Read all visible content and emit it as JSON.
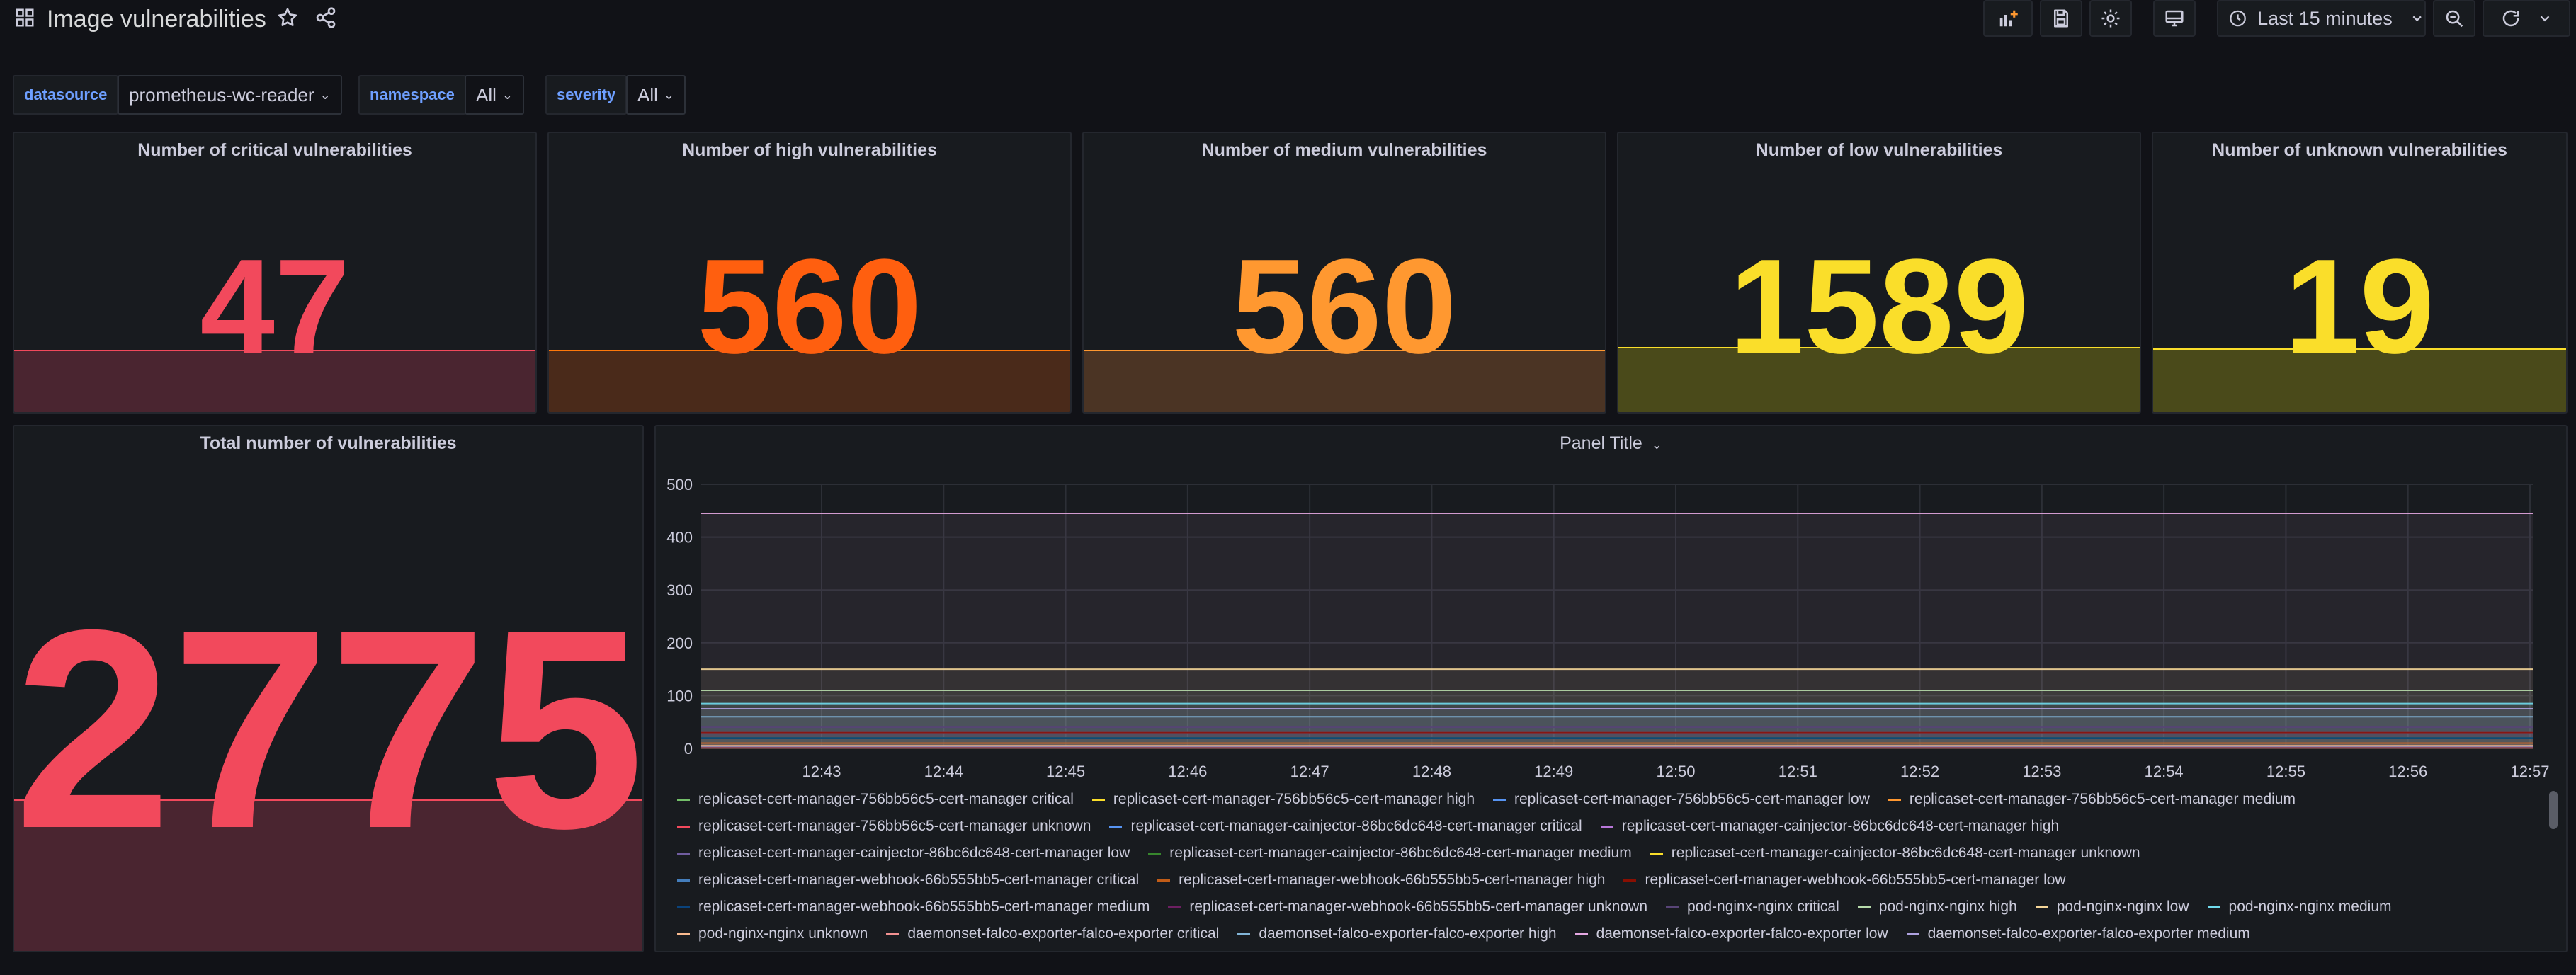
{
  "dashboard": {
    "title": "Image vulnerabilities"
  },
  "toolbar": {
    "time_range": "Last 15 minutes"
  },
  "variables": [
    {
      "label": "datasource",
      "value": "prometheus-wc-reader"
    },
    {
      "label": "namespace",
      "value": "All"
    },
    {
      "label": "severity",
      "value": "All"
    }
  ],
  "stats": [
    {
      "title": "Number of critical vulnerabilities",
      "value": "47",
      "color": "#f2495c",
      "spark": "#4a2530",
      "line": "#f2495c"
    },
    {
      "title": "Number of high vulnerabilities",
      "value": "560",
      "color": "#ff5f0f",
      "spark": "#4a2a1a",
      "line": "#ff780a"
    },
    {
      "title": "Number of medium vulnerabilities",
      "value": "560",
      "color": "#ff9830",
      "spark": "#4b3424",
      "line": "#ff9830"
    },
    {
      "title": "Number of low vulnerabilities",
      "value": "1589",
      "color": "#fade2a",
      "spark": "#4a4a1a",
      "line": "#fade2a"
    },
    {
      "title": "Number of unknown vulnerabilities",
      "value": "19",
      "color": "#fade2a",
      "spark": "#4a4a1a",
      "line": "#fade2a"
    }
  ],
  "total": {
    "title": "Total number of vulnerabilities",
    "value": "2775",
    "color": "#f2495c",
    "spark": "#4a2530",
    "line": "#f2495c"
  },
  "timeseries": {
    "title": "Panel Title"
  },
  "chart_data": {
    "type": "area",
    "title": "Panel Title",
    "x": [
      "12:43",
      "12:44",
      "12:45",
      "12:46",
      "12:47",
      "12:48",
      "12:49",
      "12:50",
      "12:51",
      "12:52",
      "12:53",
      "12:54",
      "12:55",
      "12:56",
      "12:57"
    ],
    "yticks": [
      0,
      100,
      200,
      300,
      400,
      500
    ],
    "ylim": [
      0,
      500
    ],
    "grid": true,
    "legend_placement": "bottom",
    "series": [
      {
        "name": "replicaset-cert-manager-756bb56c5-cert-manager critical",
        "color": "#73bf69",
        "value": 2
      },
      {
        "name": "replicaset-cert-manager-756bb56c5-cert-manager high",
        "color": "#fade2a",
        "value": 10
      },
      {
        "name": "replicaset-cert-manager-756bb56c5-cert-manager low",
        "color": "#5794f2",
        "value": 30
      },
      {
        "name": "replicaset-cert-manager-756bb56c5-cert-manager medium",
        "color": "#ff9830",
        "value": 20
      },
      {
        "name": "replicaset-cert-manager-756bb56c5-cert-manager unknown",
        "color": "#f2495c",
        "value": 1
      },
      {
        "name": "replicaset-cert-manager-cainjector-86bc6dc648-cert-manager critical",
        "color": "#5794f2",
        "value": 2
      },
      {
        "name": "replicaset-cert-manager-cainjector-86bc6dc648-cert-manager high",
        "color": "#b877d9",
        "value": 10
      },
      {
        "name": "replicaset-cert-manager-cainjector-86bc6dc648-cert-manager low",
        "color": "#705da0",
        "value": 30
      },
      {
        "name": "replicaset-cert-manager-cainjector-86bc6dc648-cert-manager medium",
        "color": "#37872d",
        "value": 20
      },
      {
        "name": "replicaset-cert-manager-cainjector-86bc6dc648-cert-manager unknown",
        "color": "#fade2a",
        "value": 1
      },
      {
        "name": "replicaset-cert-manager-webhook-66b555bb5-cert-manager critical",
        "color": "#447ebc",
        "value": 2
      },
      {
        "name": "replicaset-cert-manager-webhook-66b555bb5-cert-manager high",
        "color": "#c15c17",
        "value": 10
      },
      {
        "name": "replicaset-cert-manager-webhook-66b555bb5-cert-manager low",
        "color": "#890f02",
        "value": 30
      },
      {
        "name": "replicaset-cert-manager-webhook-66b555bb5-cert-manager medium",
        "color": "#0a437c",
        "value": 20
      },
      {
        "name": "replicaset-cert-manager-webhook-66b555bb5-cert-manager unknown",
        "color": "#6d1f62",
        "value": 1
      },
      {
        "name": "pod-nginx-nginx critical",
        "color": "#584477",
        "value": 40
      },
      {
        "name": "pod-nginx-nginx high",
        "color": "#b7dbab",
        "value": 110
      },
      {
        "name": "pod-nginx-nginx low",
        "color": "#f4d598",
        "value": 150
      },
      {
        "name": "pod-nginx-nginx medium",
        "color": "#70dbed",
        "value": 85
      },
      {
        "name": "pod-nginx-nginx unknown",
        "color": "#f9ba8f",
        "value": 5
      },
      {
        "name": "daemonset-falco-exporter-falco-exporter critical",
        "color": "#f29191",
        "value": 3
      },
      {
        "name": "daemonset-falco-exporter-falco-exporter high",
        "color": "#82b5d8",
        "value": 60
      },
      {
        "name": "daemonset-falco-exporter-falco-exporter low",
        "color": "#e5a8e2",
        "value": 445
      },
      {
        "name": "daemonset-falco-exporter-falco-exporter medium",
        "color": "#aea2e0",
        "value": 75
      }
    ]
  }
}
